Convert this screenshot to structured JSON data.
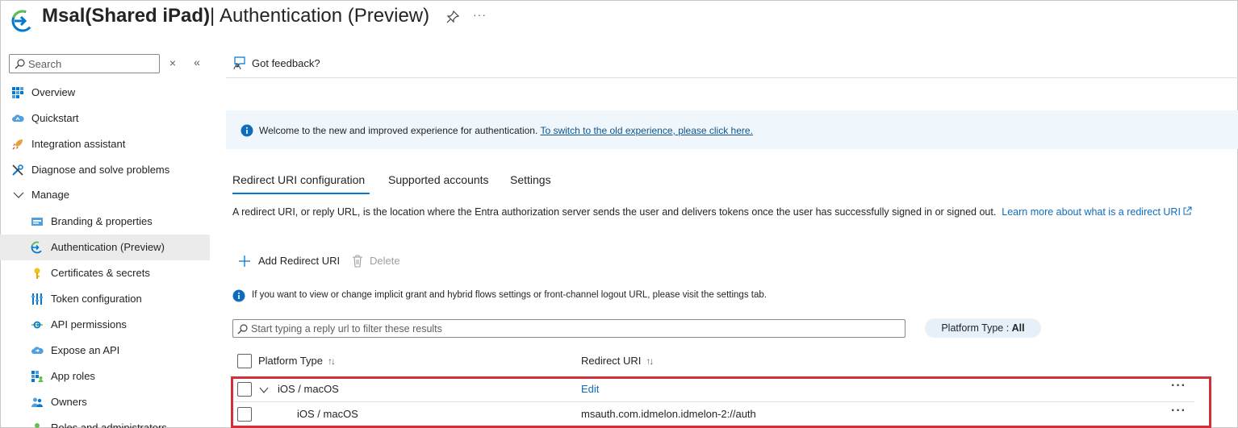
{
  "header": {
    "title_strong": "Msal(Shared iPad)",
    "separator": "|",
    "title_light": "Authentication (Preview)",
    "more": "···"
  },
  "sidebar": {
    "search": {
      "placeholder": "Search"
    },
    "clear_glyph": "×",
    "collapse_glyph": "«",
    "items": [
      {
        "label": "Overview",
        "icon": "overview-grid-icon"
      },
      {
        "label": "Quickstart",
        "icon": "cloud-icon"
      },
      {
        "label": "Integration assistant",
        "icon": "rocket-icon"
      },
      {
        "label": "Diagnose and solve problems",
        "icon": "wrench-icon"
      },
      {
        "label": "Manage",
        "icon": "chevron-down-icon"
      },
      {
        "label": "Branding & properties",
        "icon": "branding-icon"
      },
      {
        "label": "Authentication (Preview)",
        "icon": "authentication-icon",
        "active": true
      },
      {
        "label": "Certificates & secrets",
        "icon": "key-icon"
      },
      {
        "label": "Token configuration",
        "icon": "token-bars-icon"
      },
      {
        "label": "API permissions",
        "icon": "api-permissions-icon"
      },
      {
        "label": "Expose an API",
        "icon": "cloud-expose-icon"
      },
      {
        "label": "App roles",
        "icon": "app-roles-icon"
      },
      {
        "label": "Owners",
        "icon": "owners-icon"
      },
      {
        "label": "Roles and administrators",
        "icon": "roles-icon"
      }
    ]
  },
  "command_bar": {
    "feedback_label": "Got feedback?"
  },
  "banner": {
    "text": "Welcome to the new and improved experience for authentication.",
    "link": "To switch to the old experience, please click here."
  },
  "tabs": [
    {
      "label": "Redirect URI configuration",
      "active": true
    },
    {
      "label": "Supported accounts"
    },
    {
      "label": "Settings"
    }
  ],
  "description": {
    "text": "A redirect URI, or reply URL, is the location where the Entra authorization server sends the user and delivers tokens once the user has successfully signed in or signed out.",
    "link": "Learn more about what is a redirect URI"
  },
  "toolbar": {
    "add_label": "Add Redirect URI",
    "delete_label": "Delete"
  },
  "info_note": "If you want to view or change implicit grant and hybrid flows settings or front-channel logout URL, please visit the settings tab.",
  "filter": {
    "placeholder": "Start typing a reply url to filter these results",
    "pill_label": "Platform Type : ",
    "pill_value": "All"
  },
  "table": {
    "columns": [
      "Platform Type",
      "Redirect URI"
    ],
    "sort_glyph": "↑↓",
    "rows": [
      {
        "platform": "iOS / macOS",
        "uri": "Edit",
        "group": true
      },
      {
        "platform": "iOS / macOS",
        "uri": "msauth.com.idmelon.idmelon-2://auth",
        "group": false
      }
    ],
    "row_menu": "···"
  },
  "colors": {
    "accent": "#0078d4",
    "link": "#0f6cbd",
    "banner_bg": "#eff6fc",
    "highlight": "#d32f3a"
  }
}
